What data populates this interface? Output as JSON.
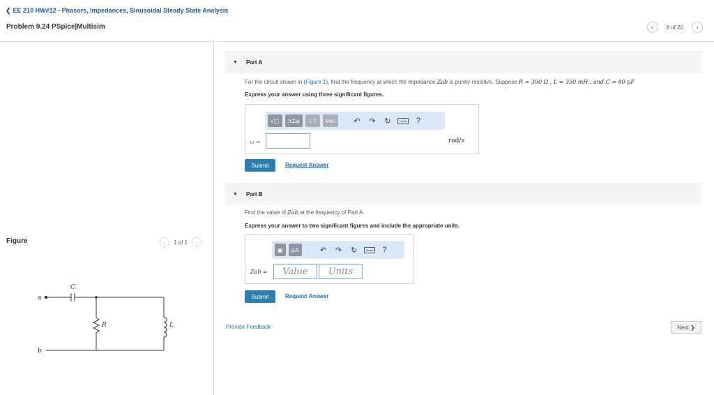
{
  "header": {
    "assignment_title": "EE 210 HW#12 - Phasors, Impedances, Sinusoidal Steady State Analysis",
    "problem_title": "Problem 9.24 PSpice|Multisim",
    "pager_text": "8 of 20"
  },
  "figure": {
    "label": "Figure",
    "pager_text": "1 of 1",
    "nodes": {
      "a": "a",
      "b": "b"
    },
    "components": {
      "C": "C",
      "R": "R",
      "L": "L"
    }
  },
  "part_a": {
    "title": "Part A",
    "question_pre": "For the circuit shown in ",
    "figure_link": "(Figure 1)",
    "question_mid": ", find the frequency at which the impedance ",
    "zab": "Zab",
    "question_post": " is purely resistive. Suppose ",
    "r_value": "R = 300 Ω , L = 350 mH , and C = 80 μF",
    "instruction": "Express your answer using three significant figures.",
    "toolbar": {
      "sqrt_label": "√□",
      "greek_label": "ΑΣφ",
      "sort_label": "↓↑",
      "vec_label": "vec",
      "help": "?"
    },
    "var_label": "ω =",
    "unit": "rad/s",
    "submit": "Submit",
    "request_answer": "Request Answer"
  },
  "part_b": {
    "title": "Part B",
    "question_pre": "Find the value of ",
    "zab": "Zab",
    "question_post": " at the frequency of Part A.",
    "instruction": "Express your answer to two significant figures and include the appropriate units.",
    "toolbar": {
      "mu_label": "μA",
      "help": "?"
    },
    "var_label": "Zab =",
    "value_placeholder": "Value",
    "units_placeholder": "Units",
    "submit": "Submit",
    "request_answer": "Request Answer"
  },
  "footer": {
    "feedback": "Provide Feedback",
    "next": "Next"
  }
}
